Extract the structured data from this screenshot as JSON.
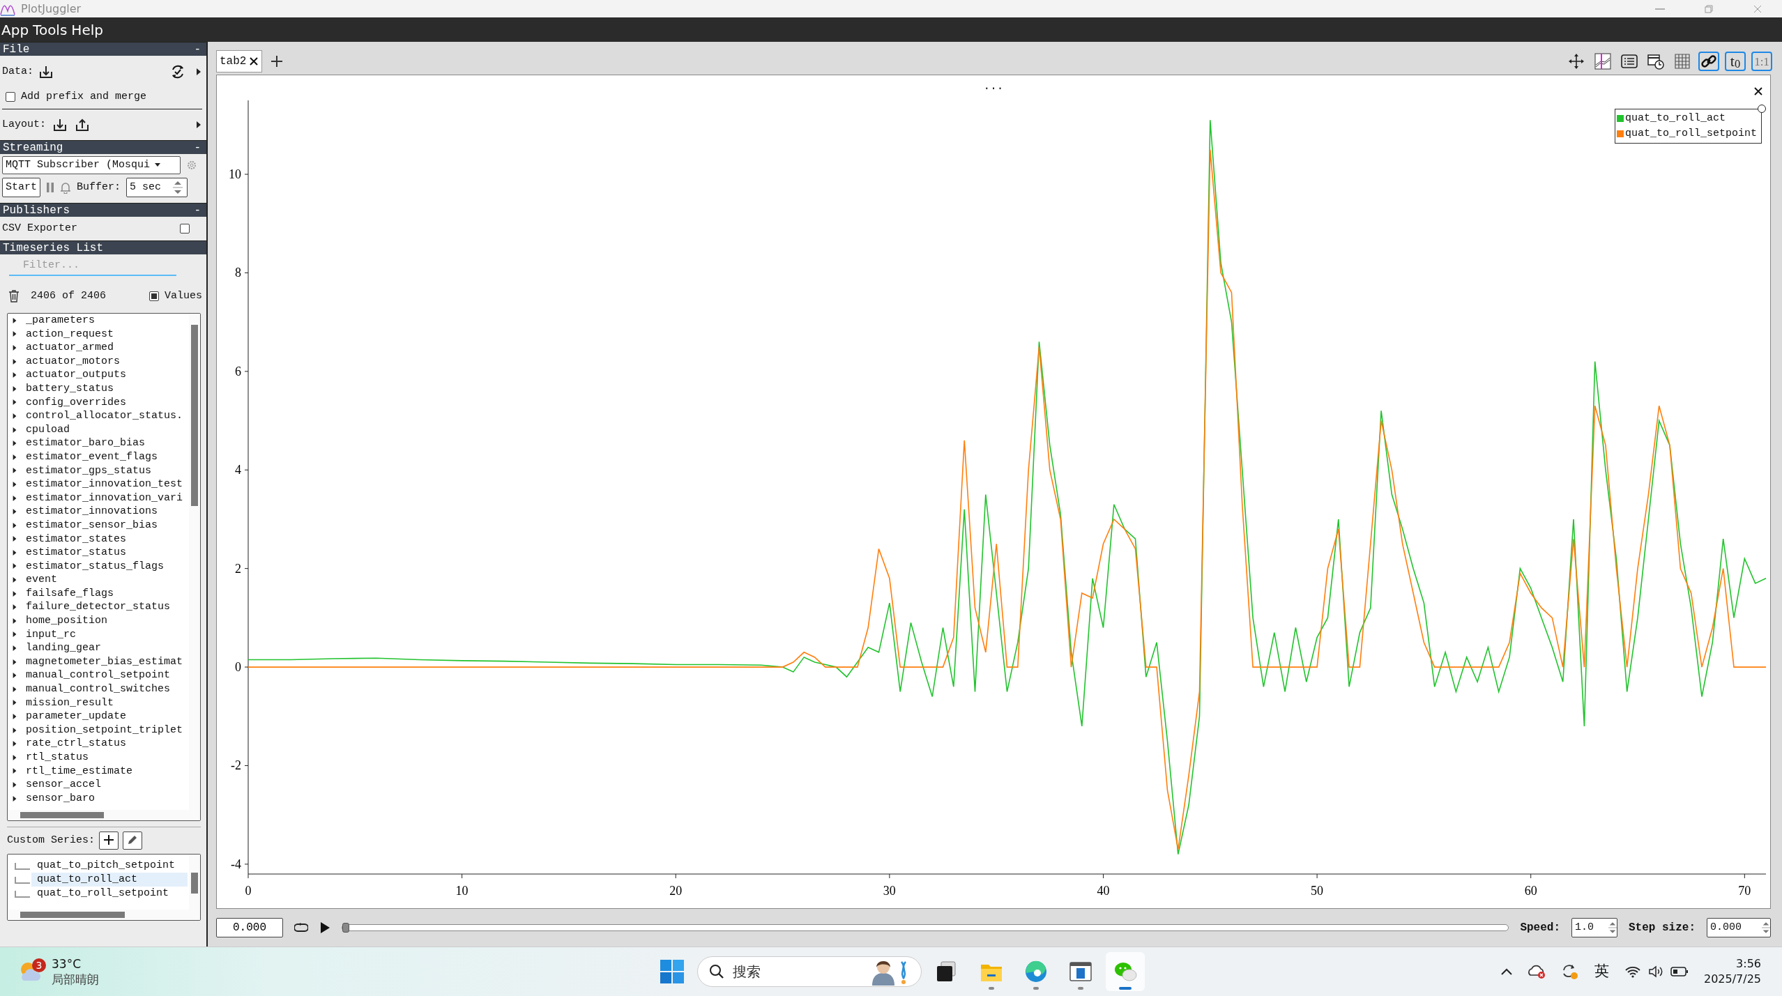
{
  "window": {
    "title": "PlotJuggler"
  },
  "menu": [
    {
      "label": "App"
    },
    {
      "label": "Tools"
    },
    {
      "label": "Help"
    }
  ],
  "sidebar": {
    "file": {
      "header": "File",
      "collapse": "-",
      "data_label": "Data:",
      "merge": {
        "label": "Add prefix and merge",
        "checked": false
      },
      "layout_label": "Layout:"
    },
    "streaming": {
      "header": "Streaming",
      "collapse": "-",
      "source": "MQTT Subscriber (Mosqui",
      "start": "Start",
      "buffer_label": "Buffer:",
      "buffer": "5 sec"
    },
    "publishers": {
      "header": "Publishers",
      "collapse": "-",
      "items": [
        {
          "label": "CSV Exporter",
          "checked": false
        }
      ]
    },
    "timeseries": {
      "header": "Timeseries List",
      "filter_placeholder": "Filter...",
      "count": "2406 of 2406",
      "values": {
        "label": "Values",
        "checked": true
      },
      "items": [
        "_parameters",
        "action_request",
        "actuator_armed",
        "actuator_motors",
        "actuator_outputs",
        "battery_status",
        "config_overrides",
        "control_allocator_status.",
        "cpuload",
        "estimator_baro_bias",
        "estimator_event_flags",
        "estimator_gps_status",
        "estimator_innovation_test",
        "estimator_innovation_vari",
        "estimator_innovations",
        "estimator_sensor_bias",
        "estimator_states",
        "estimator_status",
        "estimator_status_flags",
        "event",
        "failsafe_flags",
        "failure_detector_status",
        "home_position",
        "input_rc",
        "landing_gear",
        "magnetometer_bias_estimat",
        "manual_control_setpoint",
        "manual_control_switches",
        "mission_result",
        "parameter_update",
        "position_setpoint_triplet",
        "rate_ctrl_status",
        "rtl_status",
        "rtl_time_estimate",
        "sensor_accel",
        "sensor_baro"
      ]
    },
    "custom_series": {
      "label": "Custom Series:",
      "items": [
        {
          "label": "quat_to_pitch_setpoint",
          "selected": false
        },
        {
          "label": "quat_to_roll_act",
          "selected": true
        },
        {
          "label": "quat_to_roll_setpoint",
          "selected": false
        }
      ]
    }
  },
  "tabs": [
    {
      "label": "tab2",
      "selected": true
    }
  ],
  "toolbar": [
    {
      "kind": "move",
      "on": false
    },
    {
      "kind": "cursor",
      "on": false
    },
    {
      "kind": "list",
      "on": false
    },
    {
      "kind": "calendar",
      "on": false
    },
    {
      "kind": "grid",
      "on": false
    },
    {
      "kind": "link",
      "on": true
    },
    {
      "kind": "time_zero",
      "label": "t$_{0}$",
      "on": true
    },
    {
      "kind": "ratio",
      "label": "1:1",
      "on": true
    }
  ],
  "plot": {
    "handle": "...",
    "chart_data": {
      "type": "line",
      "legend": "upper right",
      "xlim": [
        0,
        71
      ],
      "ylim": [
        -4.2,
        11.5
      ],
      "xticks": [
        0,
        10,
        20,
        30,
        40,
        50,
        60,
        70
      ],
      "yticks": [
        -4,
        -2,
        0,
        2,
        4,
        6,
        8,
        10
      ],
      "x": [
        0,
        2,
        4,
        6,
        8,
        10,
        12,
        14,
        16,
        18,
        20,
        22,
        24,
        25,
        25.5,
        26,
        26.5,
        27,
        27.5,
        28,
        28.5,
        29,
        29.5,
        30,
        30.5,
        31,
        31.5,
        32,
        32.5,
        33,
        33.5,
        34,
        34.5,
        35,
        35.5,
        36,
        36.5,
        37,
        37.5,
        38,
        38.5,
        39,
        39.5,
        40,
        40.5,
        41,
        41.5,
        42,
        42.5,
        43,
        43.5,
        44,
        44.5,
        45,
        45.5,
        46,
        46.5,
        47,
        47.5,
        48,
        48.5,
        49,
        49.5,
        50,
        50.5,
        51,
        51.5,
        52,
        52.5,
        53,
        53.5,
        54,
        54.5,
        55,
        55.5,
        56,
        56.5,
        57,
        57.5,
        58,
        58.5,
        59,
        59.5,
        60,
        60.5,
        61,
        61.5,
        62,
        62.5,
        63,
        63.5,
        64,
        64.5,
        65,
        65.5,
        66,
        66.5,
        67,
        67.5,
        68,
        68.5,
        69,
        69.5,
        70,
        70.5,
        71
      ],
      "series": [
        {
          "name": "quat_to_roll_act",
          "color": "#22c32e",
          "values": [
            0.15,
            0.15,
            0.17,
            0.18,
            0.15,
            0.13,
            0.12,
            0.1,
            0.08,
            0.07,
            0.05,
            0.05,
            0.04,
            0,
            -0.1,
            0.2,
            0.1,
            0.05,
            0,
            -0.2,
            0.1,
            0.4,
            0.3,
            1.3,
            -0.5,
            0.9,
            0.1,
            -0.6,
            0.8,
            -0.4,
            3.2,
            -0.5,
            3.5,
            1.5,
            -0.5,
            0.5,
            2.0,
            6.6,
            4.5,
            3.1,
            0.3,
            -1.2,
            1.8,
            0.8,
            3.3,
            2.8,
            2.6,
            -0.2,
            0.5,
            -1.5,
            -3.8,
            -2.8,
            -1.0,
            11.1,
            8.2,
            7.0,
            4.0,
            1.0,
            -0.4,
            0.7,
            -0.5,
            0.8,
            -0.3,
            0.6,
            1.0,
            3.0,
            -0.4,
            0.7,
            1.2,
            5.2,
            3.5,
            2.8,
            2.0,
            1.3,
            -0.4,
            0.3,
            -0.5,
            0.2,
            -0.3,
            0.4,
            -0.5,
            0.2,
            2.0,
            1.6,
            1.0,
            0.4,
            -0.3,
            3.0,
            -1.2,
            6.2,
            4.0,
            2.2,
            -0.5,
            1.0,
            3.0,
            5.0,
            4.5,
            2.5,
            1.2,
            -0.6,
            0.5,
            2.6,
            1.0,
            2.2,
            1.7,
            1.8
          ]
        },
        {
          "name": "quat_to_roll_setpoint",
          "color": "#ff7f0e",
          "values": [
            0,
            0,
            0,
            0,
            0,
            0,
            0,
            0,
            0,
            0,
            0,
            0,
            0,
            0,
            0.1,
            0.3,
            0.2,
            0,
            0,
            0,
            0,
            0.8,
            2.4,
            1.8,
            0,
            0,
            0,
            0,
            0,
            0.6,
            4.6,
            1.2,
            0.3,
            2.5,
            0,
            0,
            4.0,
            6.5,
            4.0,
            3.0,
            0,
            1.5,
            1.4,
            2.5,
            3.0,
            2.8,
            2.4,
            0,
            0,
            -2.5,
            -3.7,
            -2.2,
            -0.5,
            10.5,
            8.0,
            7.6,
            3.3,
            0,
            0,
            0,
            0,
            0,
            0,
            0,
            2.0,
            2.8,
            0,
            0,
            2.5,
            5.0,
            4.0,
            2.5,
            1.5,
            0.5,
            0,
            0,
            0,
            0,
            0,
            0,
            0,
            0.5,
            1.9,
            1.5,
            1.2,
            1.0,
            0,
            2.6,
            0,
            5.3,
            4.5,
            2.0,
            0,
            2.0,
            3.5,
            5.3,
            4.5,
            2.0,
            1.5,
            0,
            0.8,
            2.0,
            0,
            0,
            0,
            0
          ]
        }
      ]
    }
  },
  "playback": {
    "time": "0.000",
    "level": 0,
    "speed_label": "Speed:",
    "speed": "1.0",
    "step_label": "Step size:",
    "step": "0.000"
  },
  "taskbar": {
    "weather": {
      "badge": "3",
      "temperature": "33°C",
      "condition": "局部晴朗"
    },
    "search_placeholder": "搜索",
    "apps": [
      {
        "kind": "squares",
        "running": false,
        "active": false
      },
      {
        "kind": "folder",
        "running": true,
        "active": false
      },
      {
        "kind": "browser",
        "running": true,
        "active": false
      },
      {
        "kind": "window",
        "running": true,
        "active": false
      },
      {
        "kind": "chat",
        "running": true,
        "active": true
      }
    ],
    "language": "英",
    "time": "3:56",
    "date": "2025/7/25"
  }
}
